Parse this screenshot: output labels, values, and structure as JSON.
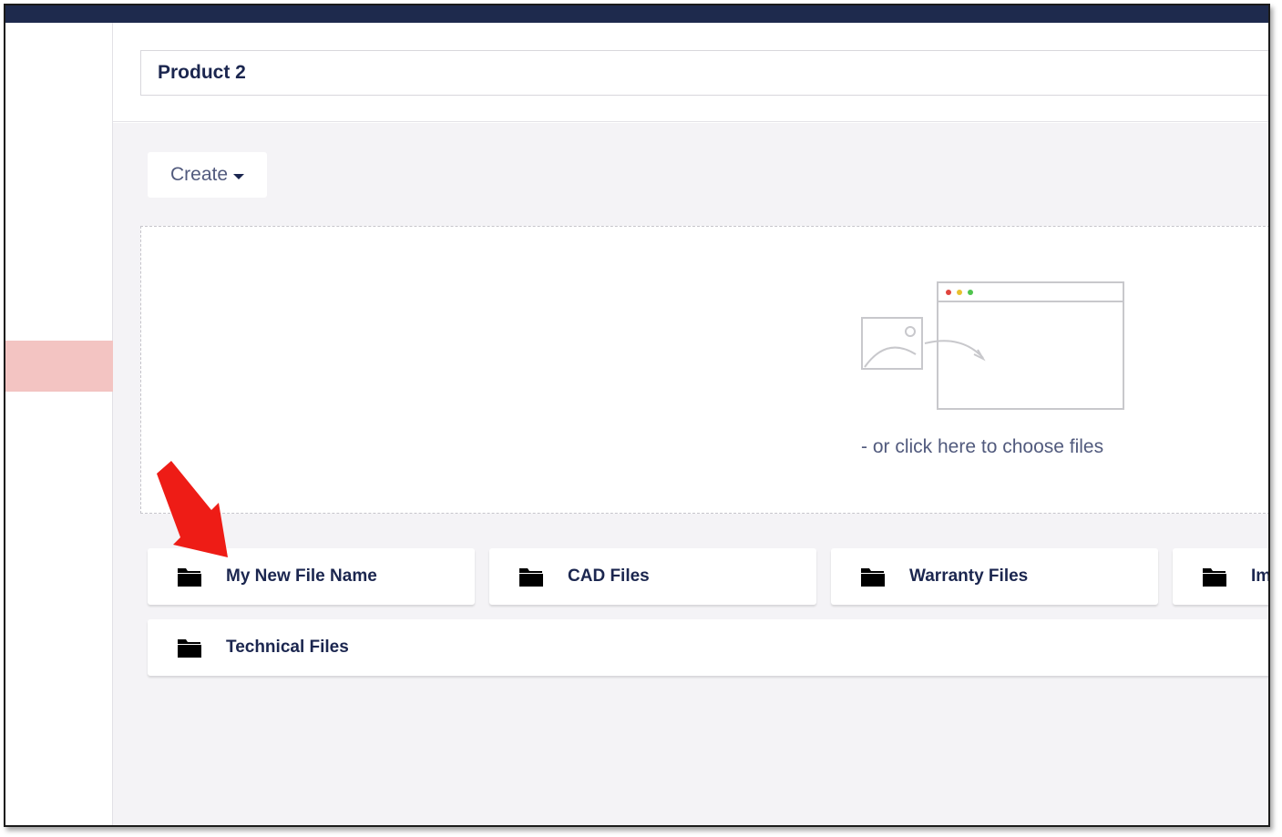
{
  "node": {
    "name_value": "Product 2"
  },
  "toolbar": {
    "create_label": "Create"
  },
  "dropzone": {
    "text": "- or click here to choose files"
  },
  "folders": [
    {
      "label": "My New File Name",
      "icon": "folder-icon"
    },
    {
      "label": "CAD Files",
      "icon": "folder-icon"
    },
    {
      "label": "Warranty Files",
      "icon": "folder-icon"
    },
    {
      "label": "Im",
      "icon": "folder-icon"
    },
    {
      "label": "Technical Files",
      "icon": "folder-icon"
    }
  ],
  "colors": {
    "topbar": "#1e2a4d",
    "sidebar_active": "#f3c4c2",
    "text_primary": "#1b264f",
    "text_secondary": "#515a7d",
    "content_bg": "#f4f3f6",
    "annotation_arrow": "#ee1c16"
  }
}
